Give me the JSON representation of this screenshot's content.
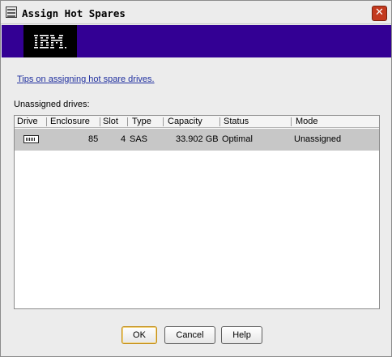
{
  "window": {
    "title": "Assign Hot Spares"
  },
  "banner": {
    "logo_text": "IBM."
  },
  "tips_link": "Tips on assigning hot spare drives.",
  "unassigned_label": "Unassigned drives:",
  "table": {
    "columns": [
      "Drive",
      "Enclosure",
      "Slot",
      "Type",
      "Capacity",
      "Status",
      "Mode"
    ],
    "rows": [
      {
        "enclosure": "85",
        "slot": "4",
        "type": "SAS",
        "capacity": "33.902 GB",
        "status": "Optimal",
        "mode": "Unassigned"
      }
    ]
  },
  "buttons": {
    "ok": "OK",
    "cancel": "Cancel",
    "help": "Help"
  },
  "colors": {
    "banner": "#330094",
    "link": "#1f2f9f",
    "selected_row": "#c7c7c7",
    "close_button": "#c33a1f"
  },
  "icons": {
    "app": "app-icon",
    "close": "close-icon",
    "drive": "drive-icon"
  }
}
